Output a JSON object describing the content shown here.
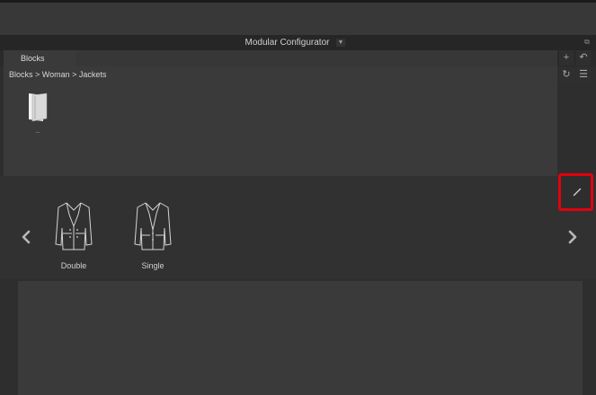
{
  "window": {
    "title": "Modular Configurator",
    "title_dropdown_icon": "caret-down-icon",
    "undock_icon": "undock-icon"
  },
  "tabs": [
    {
      "label": "Blocks",
      "active": true
    }
  ],
  "browser": {
    "breadcrumb": "Blocks > Woman > Jackets",
    "items": [
      {
        "label": "..",
        "icon": "folder-up-icon"
      }
    ],
    "side_buttons": {
      "add_icon": "plus-icon",
      "undo_icon": "undo-icon",
      "refresh_icon": "refresh-icon",
      "list_icon": "list-view-icon"
    }
  },
  "carousel": {
    "items": [
      {
        "label": "Double",
        "icon": "double-breasted-jacket-icon"
      },
      {
        "label": "Single",
        "icon": "single-breasted-jacket-icon"
      }
    ],
    "edit_icon": "pencil-icon",
    "prev_icon": "chevron-left-icon",
    "next_icon": "chevron-right-icon"
  },
  "colors": {
    "highlight": "#e3000f",
    "panel": "#3a3a3a",
    "background": "#2e2e2e"
  }
}
